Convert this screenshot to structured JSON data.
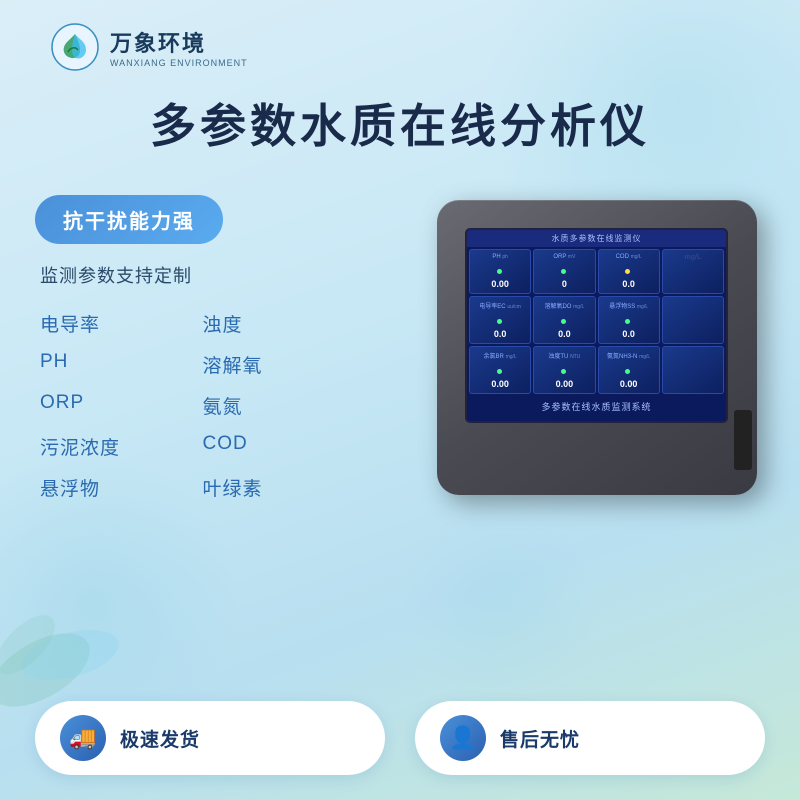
{
  "brand": {
    "logo_cn": "万象环境",
    "logo_en": "WANXIANG ENVIRONMENT"
  },
  "main_title": "多参数水质在线分析仪",
  "features": {
    "highlight": "抗干扰能力强",
    "subtitle": "监测参数支持定制",
    "items": [
      "电导率",
      "浊度",
      "PH",
      "溶解氧",
      "ORP",
      "氨氮",
      "污泥浓度",
      "COD",
      "悬浮物",
      "叶绿素"
    ]
  },
  "device": {
    "screen_title": "水质多参数在线监测仪",
    "bottom_label": "多参数在线水质监测系统",
    "cells": [
      {
        "label": "PH",
        "unit": "ph",
        "value": "0.00",
        "dot": "green"
      },
      {
        "label": "ORP",
        "unit": "mV",
        "value": "0",
        "dot": "green"
      },
      {
        "label": "COD",
        "unit": "mg/L",
        "value": "0.0",
        "dot": "yellow"
      },
      {
        "label": "电导率EC",
        "unit": "uu/cm",
        "value": "0.0",
        "dot": "green"
      },
      {
        "label": "溶解氧DO",
        "unit": "mg/L",
        "value": "0.0",
        "dot": "green"
      },
      {
        "label": "悬浮物SS",
        "unit": "mg/L",
        "value": "0.0",
        "dot": "green"
      },
      {
        "label": "余氯BR",
        "unit": "mg/L",
        "value": "0.00",
        "dot": "green"
      },
      {
        "label": "浊度TU",
        "unit": "NTU",
        "value": "0.00",
        "dot": "green"
      },
      {
        "label": "氨氮NH3-N",
        "unit": "mg/L",
        "value": "0.00",
        "dot": "green"
      }
    ]
  },
  "bottom_badges": [
    {
      "icon": "🚚",
      "text": "极速发货"
    },
    {
      "icon": "👤",
      "text": "售后无忧"
    }
  ]
}
